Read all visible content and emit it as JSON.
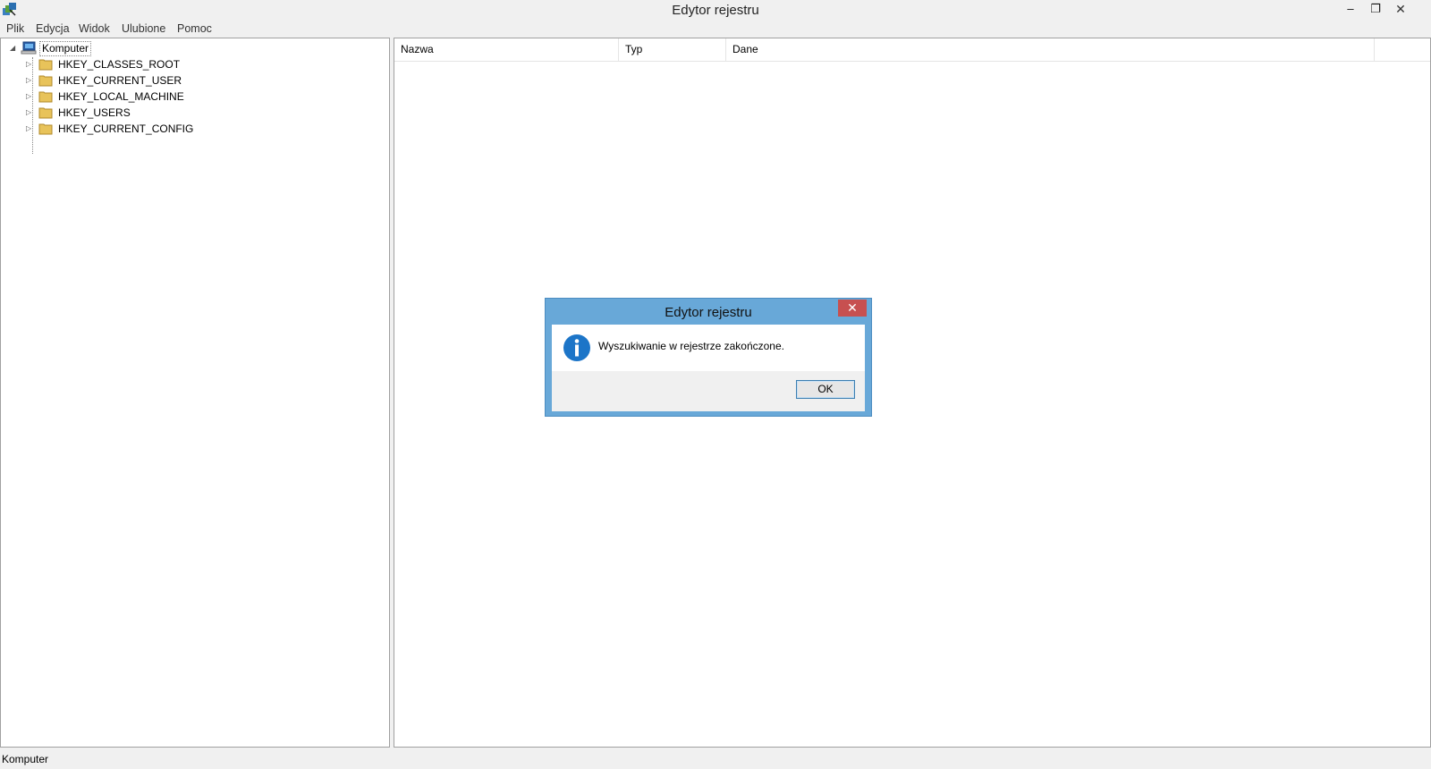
{
  "window": {
    "title": "Edytor rejestru",
    "controls": {
      "minimize": "–",
      "maximize": "❐",
      "close": "✕"
    }
  },
  "menu": [
    "Plik",
    "Edycja",
    "Widok",
    "Ulubione",
    "Pomoc"
  ],
  "tree": {
    "root": "Komputer",
    "keys": [
      "HKEY_CLASSES_ROOT",
      "HKEY_CURRENT_USER",
      "HKEY_LOCAL_MACHINE",
      "HKEY_USERS",
      "HKEY_CURRENT_CONFIG"
    ]
  },
  "list": {
    "columns": [
      "Nazwa",
      "Typ",
      "Dane"
    ]
  },
  "status": {
    "path": "Komputer"
  },
  "dialog": {
    "title": "Edytor rejestru",
    "close_glyph": "✕",
    "message": "Wyszukiwanie w rejestrze zakończone.",
    "ok_label": "OK",
    "icon": "info-icon"
  },
  "colors": {
    "dialog_frame": "#68a8d8",
    "close_button": "#c75050",
    "folder": "#e8c35a",
    "info_icon": "#1c75c8"
  }
}
